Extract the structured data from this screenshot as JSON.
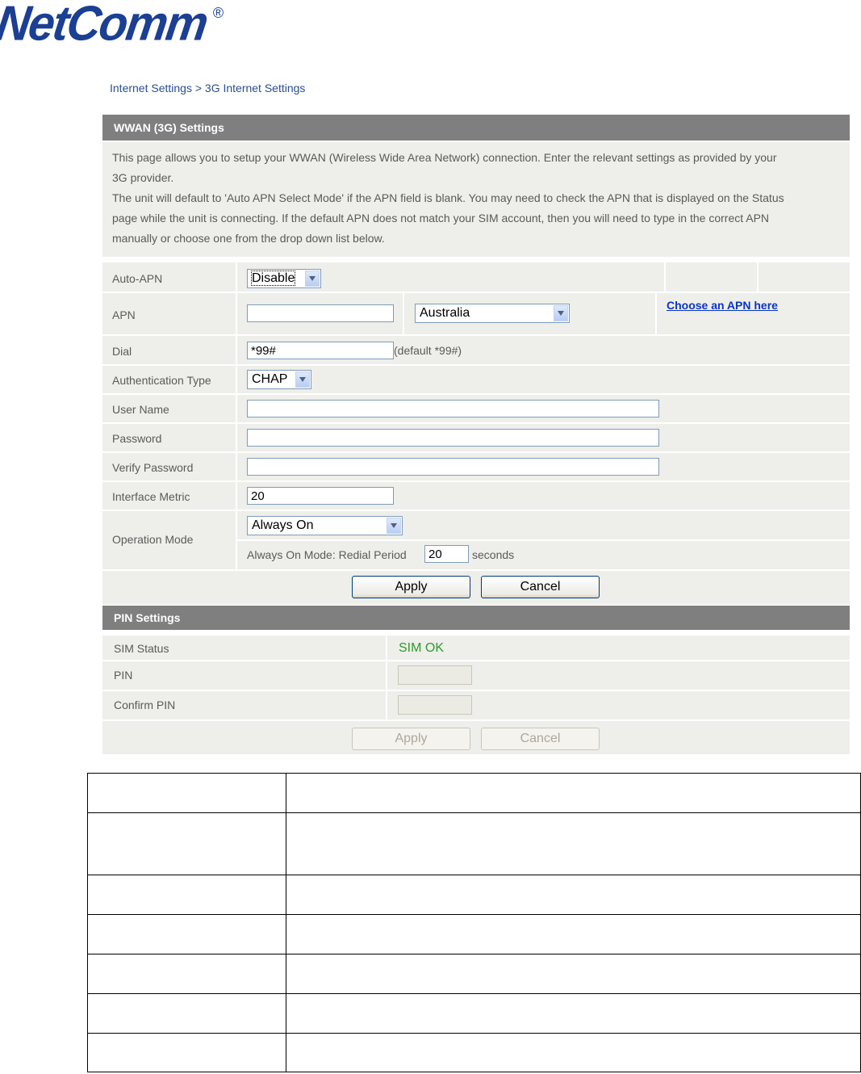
{
  "logo": {
    "text": "NetComm",
    "registered": "®"
  },
  "breadcrumb": "Internet Settings > 3G Internet Settings",
  "wwan": {
    "title": "WWAN (3G) Settings",
    "desc_lines": [
      "This page allows you to setup your WWAN (Wireless Wide Area Network) connection. Enter the relevant settings as provided by your",
      "3G provider.",
      "The unit will default to 'Auto APN Select Mode' if the APN field is blank. You may need to check the APN that is displayed on the Status",
      "page while the unit is connecting. If the default APN does not match your SIM account, then you will need to type in the correct APN",
      "manually or choose one from the drop down list below."
    ],
    "auto_apn": {
      "label": "Auto-APN",
      "value": "Disable"
    },
    "apn": {
      "label": "APN",
      "value": "",
      "country": "Australia",
      "link": "Choose an APN here"
    },
    "dial": {
      "label": "Dial",
      "value": "*99#",
      "hint": "(default *99#)"
    },
    "auth": {
      "label": "Authentication Type",
      "value": "CHAP"
    },
    "username": {
      "label": "User Name",
      "value": ""
    },
    "password": {
      "label": "Password",
      "value": ""
    },
    "verify": {
      "label": "Verify Password",
      "value": ""
    },
    "metric": {
      "label": "Interface Metric",
      "value": "20"
    },
    "opmode": {
      "label": "Operation Mode",
      "value": "Always On",
      "redial_label": "Always On Mode: Redial Period",
      "redial_value": "20",
      "redial_unit": "seconds"
    },
    "apply": "Apply",
    "cancel": "Cancel"
  },
  "pin": {
    "title": "PIN Settings",
    "sim_status_label": "SIM Status",
    "sim_status_value": "SIM OK",
    "pin_label": "PIN",
    "confirm_label": "Confirm PIN",
    "apply": "Apply",
    "cancel": "Cancel",
    "status_color": "#2e9a2e"
  }
}
